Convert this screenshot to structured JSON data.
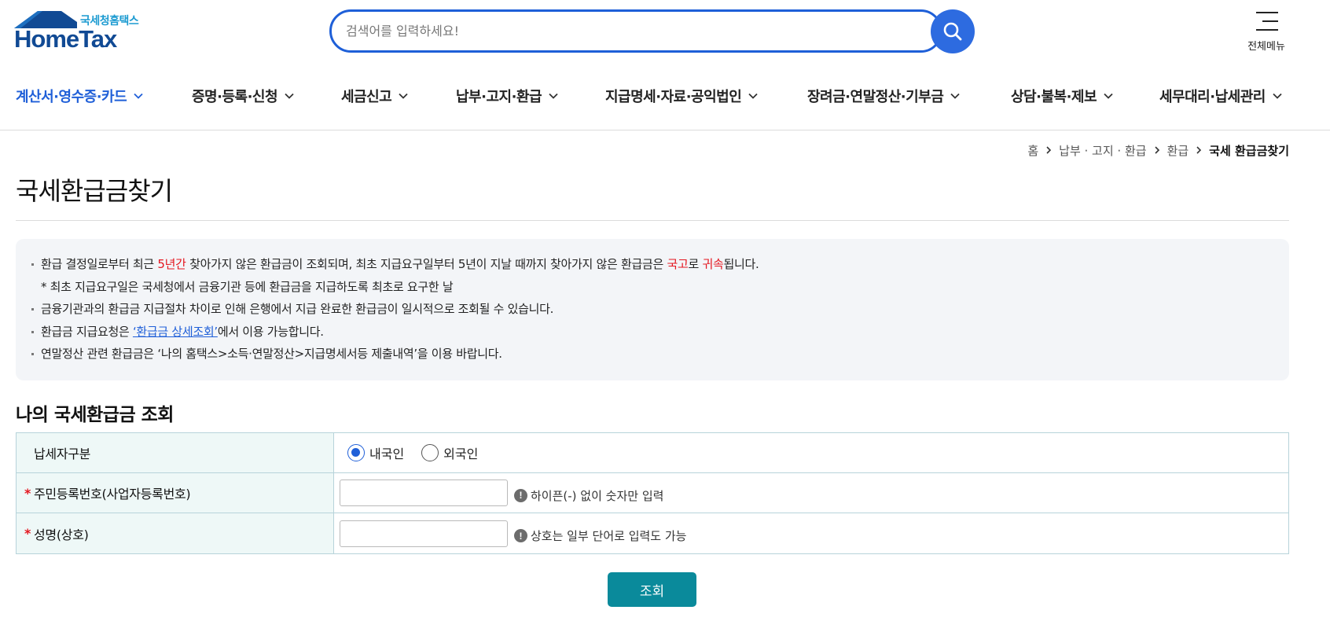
{
  "header": {
    "logo_sub": "국세청홈택스",
    "logo_main": "HomeTax",
    "search_placeholder": "검색어를 입력하세요!",
    "all_menu_label": "전체메뉴"
  },
  "gnb": {
    "items": [
      {
        "label": "계산서·영수증·카드",
        "active": true
      },
      {
        "label": "증명·등록·신청"
      },
      {
        "label": "세금신고"
      },
      {
        "label": "납부·고지·환급"
      },
      {
        "label": "지급명세·자료·공익법인"
      },
      {
        "label": "장려금·연말정산·기부금"
      },
      {
        "label": "상담·불복·제보"
      },
      {
        "label": "세무대리·납세관리"
      }
    ]
  },
  "breadcrumb": {
    "items": [
      "홈",
      "납부 · 고지 · 환급",
      "환급",
      "국세 환급금찾기"
    ]
  },
  "page": {
    "title": "국세환급금찾기"
  },
  "notice": {
    "line1": {
      "part1": "환급 결정일로부터 최근 ",
      "red1": "5년간",
      "part2": " 찾아가지 않은 환급금이 조회되며, 최초 지급요구일부터 5년이 지날 때까지 찾아가지 않은 환급금은 ",
      "red2": "국고",
      "part3": "로 ",
      "red3": "귀속",
      "part4": "됩니다."
    },
    "line2": "* 최초 지급요구일은 국세청에서 금융기관 등에 환급금을 지급하도록 최초로 요구한 날",
    "line3": "금융기관과의 환급금 지급절차 차이로 인해 은행에서 지급 완료한 환급금이 일시적으로 조회될 수 있습니다.",
    "line4": {
      "part1": "환급금 지급요청은 ",
      "link": "‘환급금 상세조회’",
      "part2": "에서 이용 가능합니다."
    },
    "line5": "연말정산 관련 환급금은 ‘나의 홈택스>소득·연말정산>지급명세서등 제출내역’을 이용 바랍니다."
  },
  "form": {
    "section_title": "나의 국세환급금 조회",
    "taxpayer_type_label": "납세자구분",
    "radio_domestic": "내국인",
    "radio_foreign": "외국인",
    "selected": "내국인",
    "id_label": "주민등록번호(사업자등록번호)",
    "id_value": "",
    "id_hint": "하이픈(-) 없이 숫자만 입력",
    "name_label": "성명(상호)",
    "name_value": "",
    "name_hint": "상호는 일부 단어로 입력도 가능",
    "required_mark": "*",
    "hint_icon": "!",
    "submit_label": "조회"
  },
  "colors": {
    "brand_blue": "#1f5fd8",
    "logo_navy": "#114a94",
    "alert_red": "#e4161f",
    "submit_teal": "#0a8a9b",
    "table_header_bg": "#eef8f7"
  }
}
